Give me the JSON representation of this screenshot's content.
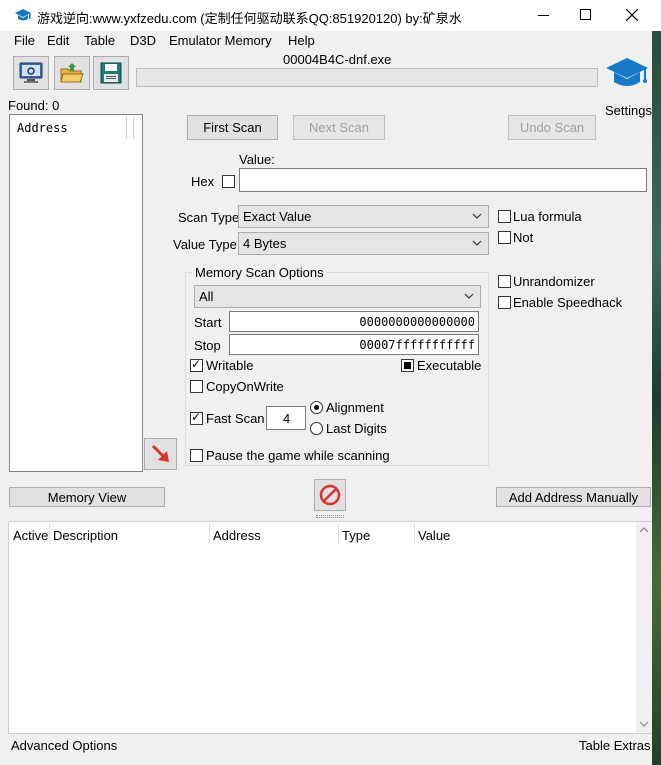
{
  "window": {
    "title": "游戏逆向:www.yxfzedu.com  (定制任何驱动联系QQ:851920120)  by:矿泉水",
    "minimize_icon": "minimize-icon",
    "maximize_icon": "maximize-icon",
    "close_icon": "close-icon"
  },
  "menu": [
    "File",
    "Edit",
    "Table",
    "D3D",
    "Emulator Memory",
    "Help"
  ],
  "toolbar": {
    "process_name": "00004B4C-dnf.exe",
    "settings_label": "Settings"
  },
  "found": {
    "label": "Found: 0"
  },
  "address_list": {
    "header": "Address"
  },
  "scan_buttons": {
    "first": "First Scan",
    "next": "Next Scan",
    "undo": "Undo Scan"
  },
  "value_section": {
    "value_label": "Value:",
    "hex_label": "Hex",
    "hex_checked": false,
    "value_input": ""
  },
  "scan_type": {
    "label": "Scan Type",
    "selected": "Exact Value"
  },
  "value_type": {
    "label": "Value Type",
    "selected": "4 Bytes"
  },
  "right_options": {
    "lua_formula": {
      "label": "Lua formula",
      "checked": false
    },
    "not": {
      "label": "Not",
      "checked": false
    },
    "unrandomizer": {
      "label": "Unrandomizer",
      "checked": false
    },
    "speedhack": {
      "label": "Enable Speedhack",
      "checked": false
    }
  },
  "memory_scan_options": {
    "title": "Memory Scan Options",
    "region": "All",
    "start_label": "Start",
    "start_value": "0000000000000000",
    "stop_label": "Stop",
    "stop_value": "00007fffffffffff",
    "writable": {
      "label": "Writable",
      "checked": true
    },
    "executable": {
      "label": "Executable",
      "state": "indeterminate"
    },
    "copyonwrite": {
      "label": "CopyOnWrite",
      "checked": false
    },
    "fast_scan": {
      "label": "Fast Scan",
      "checked": true,
      "value": "4"
    },
    "alignment": {
      "label": "Alignment",
      "selected": true
    },
    "last_digits": {
      "label": "Last Digits",
      "selected": false
    },
    "pause": {
      "label": "Pause the game while scanning",
      "checked": false
    }
  },
  "bottom_bar": {
    "memory_view": "Memory View",
    "add_address": "Add Address Manually"
  },
  "cheat_table": {
    "columns": [
      "Active",
      "Description",
      "Address",
      "Type",
      "Value"
    ]
  },
  "status_bar": {
    "advanced_options": "Advanced Options",
    "table_extras": "Table Extras"
  },
  "colors": {
    "title_bar": "#ffffff",
    "window_bg": "#f0f0f0",
    "arrow_red": "#d9342b",
    "settings_blue": "#1679c8"
  }
}
